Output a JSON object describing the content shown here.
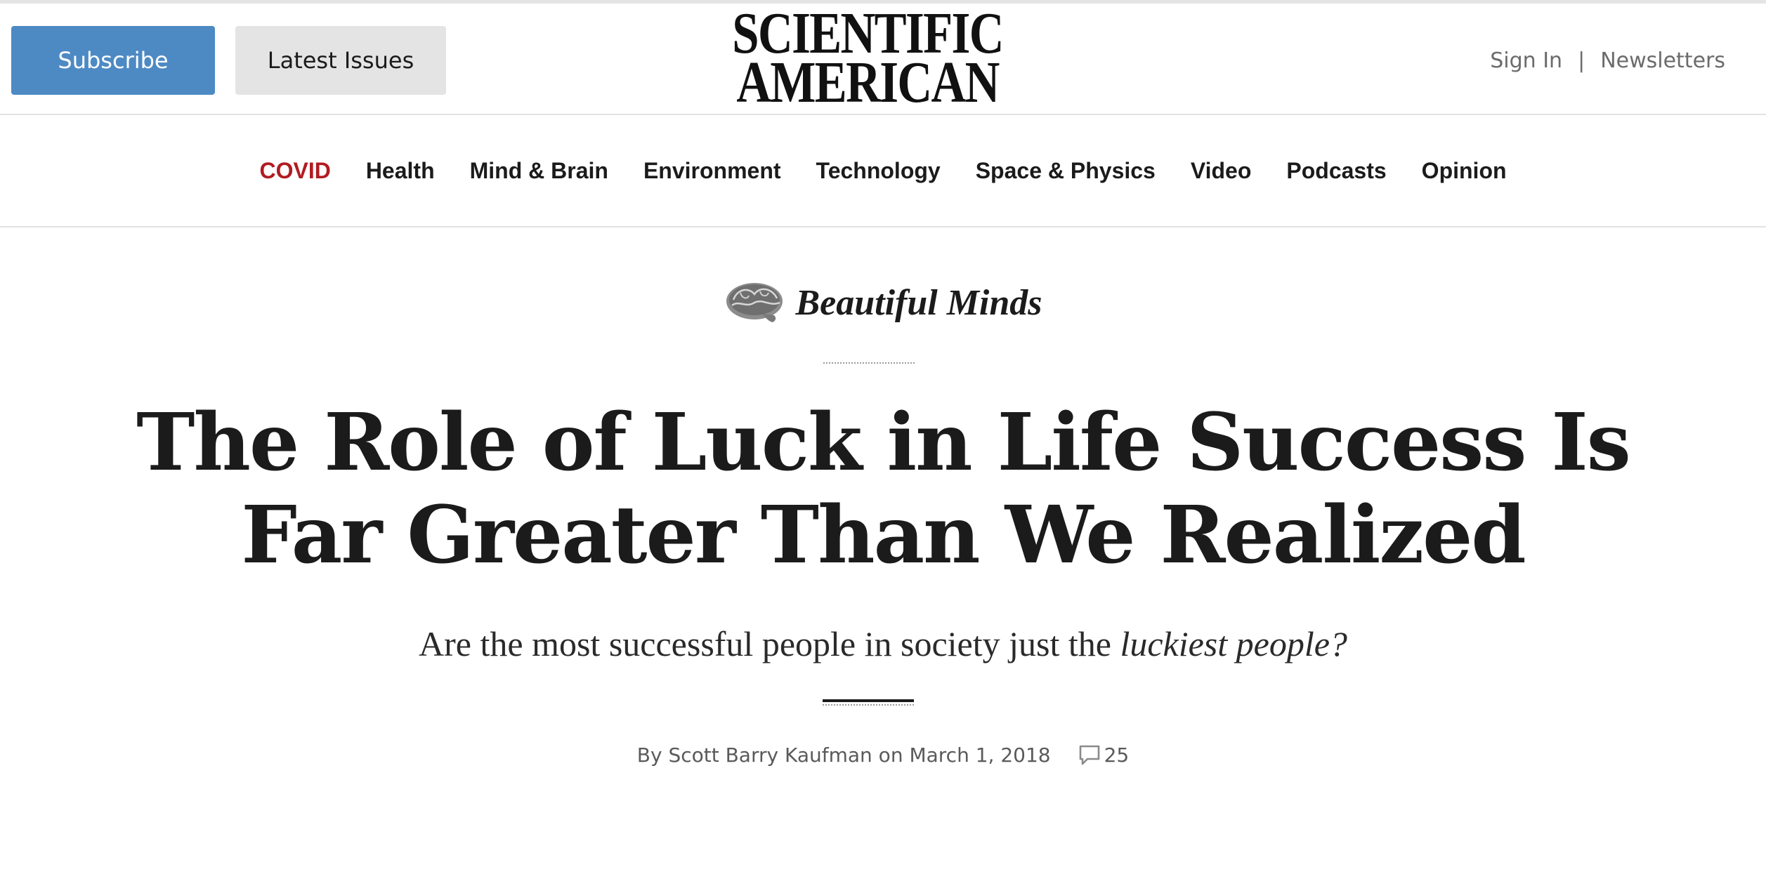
{
  "header": {
    "subscribe_label": "Subscribe",
    "latest_issues_label": "Latest Issues",
    "logo_line1": "SCIENTIFIC",
    "logo_line2": "AMERICAN",
    "sign_in_label": "Sign In",
    "separator": "|",
    "newsletters_label": "Newsletters"
  },
  "nav": {
    "items": [
      {
        "label": "COVID",
        "highlight": "#b01c22"
      },
      {
        "label": "Health"
      },
      {
        "label": "Mind & Brain"
      },
      {
        "label": "Environment"
      },
      {
        "label": "Technology"
      },
      {
        "label": "Space & Physics"
      },
      {
        "label": "Video"
      },
      {
        "label": "Podcasts"
      },
      {
        "label": "Opinion"
      }
    ]
  },
  "article": {
    "blog_icon": "brain-icon",
    "blog_name": "Beautiful Minds",
    "headline_line1": "The Role of Luck in Life Success Is",
    "headline_line2": "Far Greater Than We Realized",
    "dek_plain": "Are the most successful people in society just the ",
    "dek_italic": "luckiest people?",
    "byline_prefix": "By ",
    "author": "Scott Barry Kaufman",
    "date_prefix": " on ",
    "date": "March 1, 2018",
    "comment_icon": "comment-icon",
    "comment_count": "25"
  },
  "colors": {
    "subscribe_button": "#4d8ac4",
    "latest_issues_button": "#e4e4e4",
    "covid_accent": "#b01c22",
    "text": "#1b1b1b"
  }
}
